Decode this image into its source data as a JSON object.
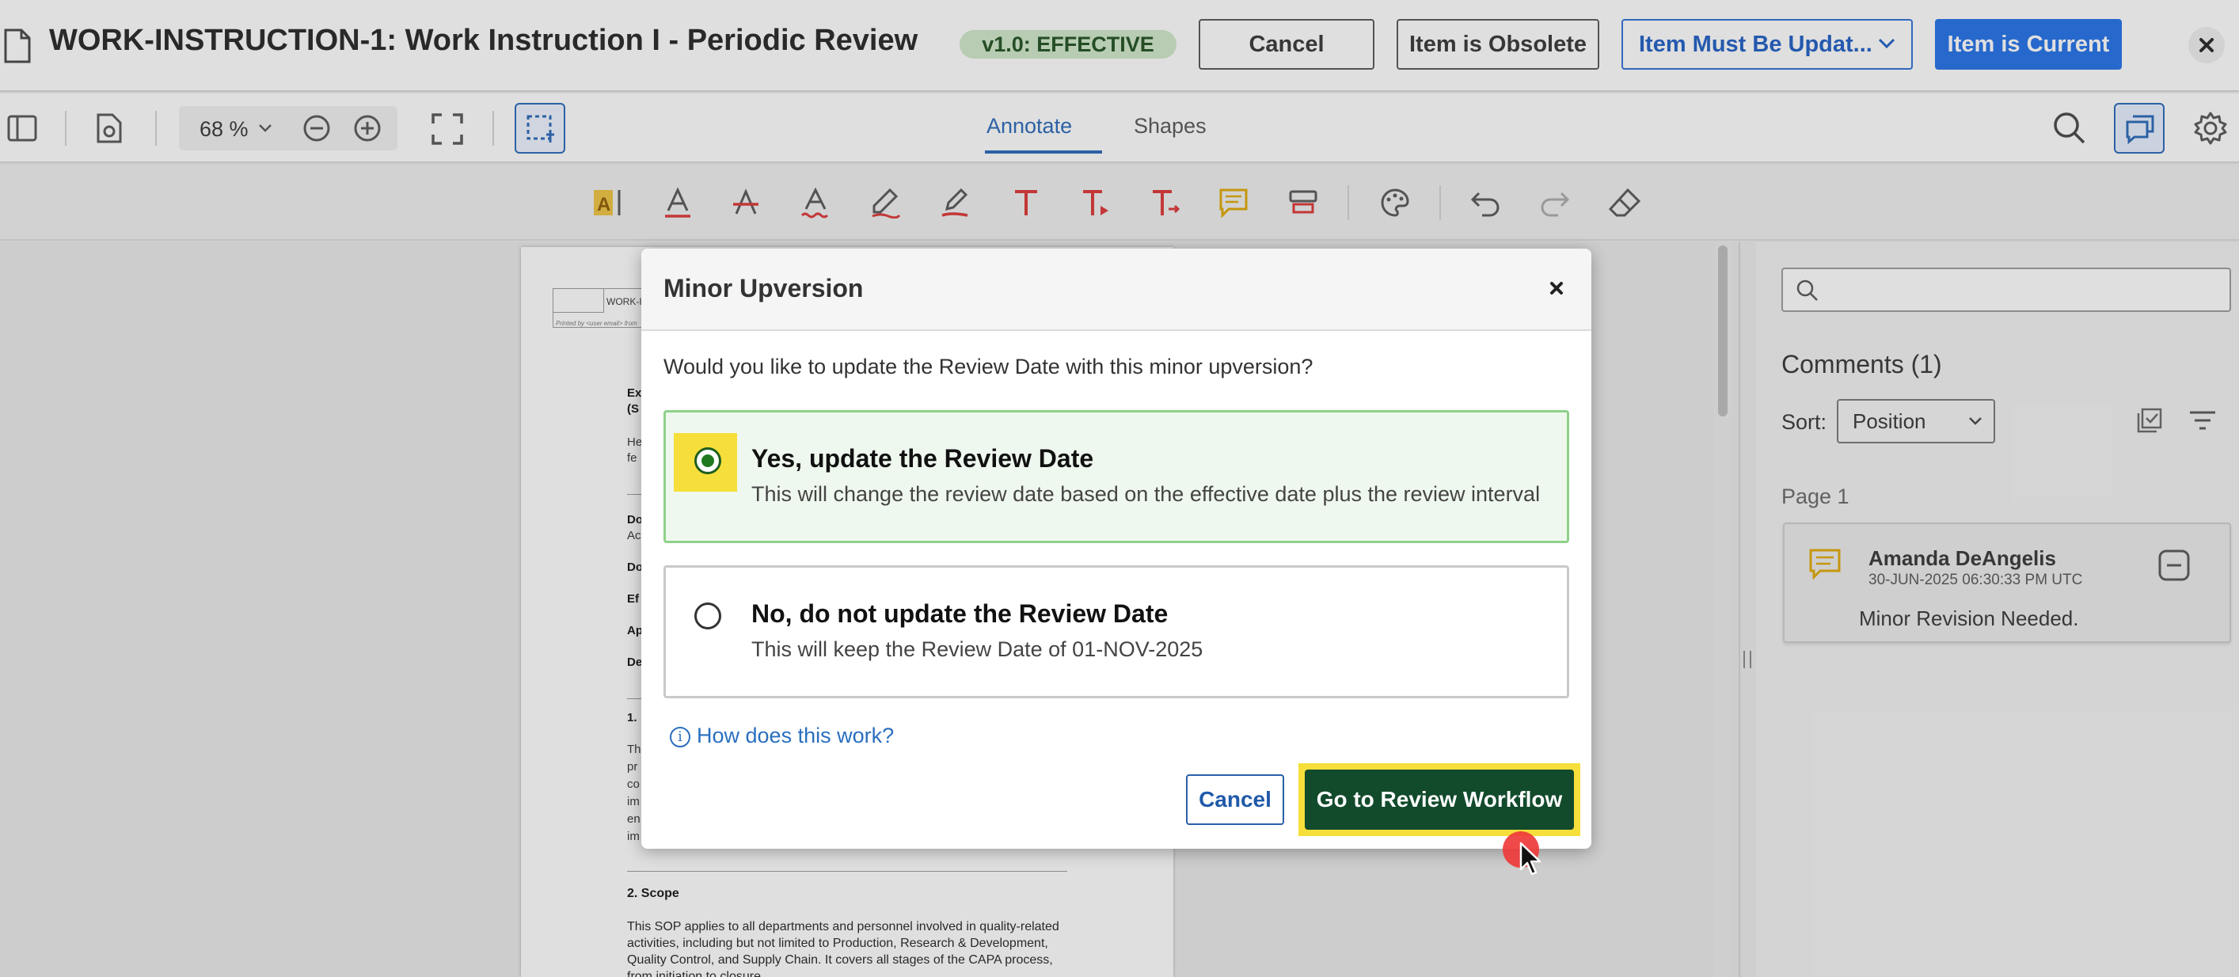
{
  "header": {
    "title": "WORK-INSTRUCTION-1: Work Instruction I - Periodic Review",
    "status_badge": "v1.0: EFFECTIVE",
    "cancel_label": "Cancel",
    "obsolete_label": "Item is Obsolete",
    "must_update_label": "Item Must Be Updat...",
    "current_label": "Item is Current",
    "colors": {
      "primary_blue": "#1f6ee8",
      "badge_green": "#cfe8c9"
    }
  },
  "toolbar": {
    "zoom_value": "68 %",
    "tabs": [
      {
        "label": "Annotate",
        "active": true
      },
      {
        "label": "Shapes",
        "active": false
      }
    ]
  },
  "annotation_tools": [
    "highlight-text-icon",
    "underline-icon",
    "strikeout-icon",
    "squiggly-icon",
    "freehand-icon",
    "free-highlight-icon",
    "free-text-icon",
    "callout-icon",
    "text-replace-icon",
    "sticky-note-icon",
    "stamp-icon",
    "style-palette-icon",
    "undo-icon",
    "redo-icon",
    "eraser-icon"
  ],
  "document": {
    "header_text": "WORK-I",
    "print_note": "Printed by <user email> from",
    "fragments": [
      "Ex",
      "(S",
      "He",
      "fe",
      "Do",
      "Ac",
      "Do",
      "Ef",
      "Ap",
      "De"
    ],
    "section1_heading": "1.",
    "section1_lines": [
      "Th",
      "pr",
      "co",
      "im",
      "en",
      "im"
    ],
    "section2_heading": "2. Scope",
    "section2_text": "This SOP applies to all departments and personnel involved in quality-related activities, including but not limited to Production, Research & Development, Quality Control, and Supply Chain. It covers all stages of the CAPA process, from initiation to closure."
  },
  "comments_panel": {
    "search_placeholder": "",
    "title": "Comments (1)",
    "sort_label": "Sort:",
    "sort_value": "Position",
    "page_group": "Page 1",
    "comments": [
      {
        "author": "Amanda DeAngelis",
        "timestamp": "30-JUN-2025 06:30:33 PM UTC",
        "body": "Minor Revision Needed."
      }
    ]
  },
  "modal": {
    "title": "Minor Upversion",
    "question": "Would you like to update the Review Date with this minor upversion?",
    "options": [
      {
        "title": "Yes, update the Review Date",
        "description": "This will change the review date based on the effective date plus the review interval",
        "selected": true
      },
      {
        "title": "No, do not update the Review Date",
        "description": "This will keep the Review Date of 01-NOV-2025",
        "selected": false
      }
    ],
    "help_link": "How does this work?",
    "cancel_label": "Cancel",
    "confirm_label": "Go to Review Workflow",
    "colors": {
      "confirm_bg": "#124a2c",
      "highlight": "#f6df3a",
      "selected_border": "#8fd18a"
    }
  }
}
